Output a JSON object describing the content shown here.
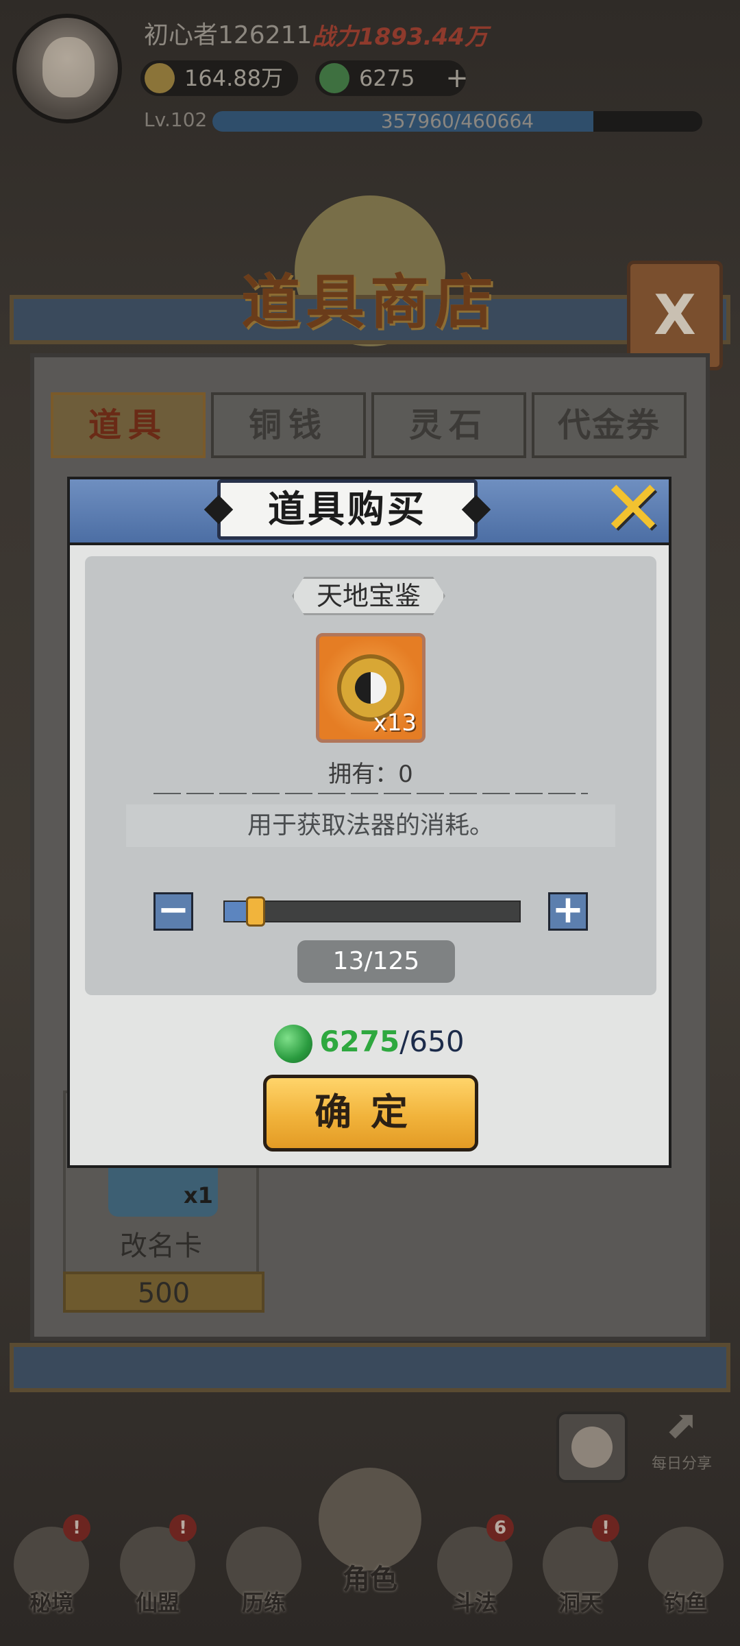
{
  "topbar": {
    "player_name": "初心者126211",
    "combat_power": "战力1893.44万",
    "copper": "164.88万",
    "jade": "6275",
    "level": "Lv.102",
    "xp": "357960/460664",
    "xp_fraction": 0.777
  },
  "shop": {
    "title": "道具商店",
    "close": "X",
    "tabs": [
      {
        "label": "道具",
        "active": true
      },
      {
        "label": "铜钱",
        "active": false
      },
      {
        "label": "灵石",
        "active": false
      },
      {
        "label": "代金券",
        "active": false
      }
    ],
    "visible_item": {
      "name": "改名卡",
      "qty": "x1",
      "price": "500"
    }
  },
  "modal": {
    "title": "道具购买",
    "item_name": "天地宝鉴",
    "item_qty": "x13",
    "owned": "拥有：0",
    "description": "用于获取法器的消耗。",
    "minus": "−",
    "plus": "+",
    "count_display": "13/125",
    "slider_fraction": 0.104,
    "cost_have": "6275",
    "cost_need": "/650",
    "confirm": "确定"
  },
  "share": {
    "label": "每日分享"
  },
  "nav": {
    "items": [
      {
        "label": "秘境",
        "badge": "!"
      },
      {
        "label": "仙盟",
        "badge": "!"
      },
      {
        "label": "历练",
        "badge": ""
      },
      {
        "label": "角色",
        "badge": ""
      },
      {
        "label": "斗法",
        "badge": "6"
      },
      {
        "label": "洞天",
        "badge": "!"
      },
      {
        "label": "钓鱼",
        "badge": ""
      }
    ]
  },
  "colors": {
    "accent_gold": "#f1b33b",
    "modal_header_blue": "#5c7fae",
    "jade_green": "#2ea83f"
  }
}
